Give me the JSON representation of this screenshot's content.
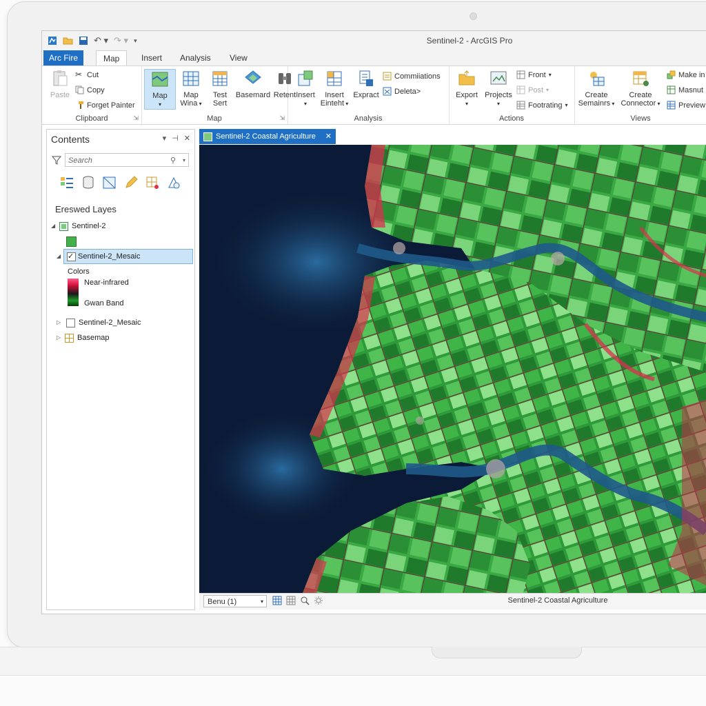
{
  "window": {
    "title": "Sentinel-2 - ArcGIS Pro"
  },
  "tabs": [
    {
      "label": "Arc Fire"
    },
    {
      "label": "Map"
    },
    {
      "label": "Insert"
    },
    {
      "label": "Analysis"
    },
    {
      "label": "View"
    }
  ],
  "ribbon": {
    "clipboard": {
      "label": "Clipboard",
      "paste": "Paste",
      "cut": "Cut",
      "copy": "Copy",
      "format_painter": "Forget Painter"
    },
    "map": {
      "label": "Map",
      "map_btn": "Map",
      "map_wina_l1": "Map",
      "map_wina_l2": "Wina",
      "test_l1": "Test",
      "test_l2": "Sert",
      "basemap": "Basemard",
      "retent": "Retent"
    },
    "analysis": {
      "label": "Analysis",
      "insert": "Insert",
      "insert_ein_l1": "Insert",
      "insert_ein_l2": "Einteht",
      "expract": "Expract",
      "commissions": "Commiiations",
      "delete": "Deleta>"
    },
    "actions": {
      "label": "Actions",
      "export": "Export",
      "projects": "Projects",
      "front": "Front",
      "post": "Post",
      "footrating": "Footrating"
    },
    "views": {
      "label": "Views",
      "create_sem_l1": "Create",
      "create_sem_l2": "Semainrs",
      "create_con_l1": "Create",
      "create_con_l2": "Connector",
      "make": "Make in",
      "masnut": "Masnut",
      "preview": "Preview"
    }
  },
  "contents": {
    "title": "Contents",
    "search_placeholder": "Search",
    "section_title": "Ereswed Layes",
    "layers": {
      "sentinel_group": "Sentinel-2",
      "mosaic_selected": "Sentinel-2_Mesaic",
      "colors_label": "Colors",
      "legend_high": "Near-infrared",
      "legend_low": "Gwan Band",
      "mosaic_second": "Sentinel-2_Mesaic",
      "basemap": "Basemap"
    }
  },
  "map": {
    "tab_title": "Sentinel-2 Coastal Agriculture",
    "scale": "Benu (1)",
    "status": "Sentinel-2 Coastal Agriculture"
  },
  "colors": {
    "accent": "#1f6fc5",
    "selection": "#cce4f7",
    "water_deep": "#0b1a36",
    "field_green": "#3fae3f",
    "vegetation_red": "#d8324f"
  }
}
